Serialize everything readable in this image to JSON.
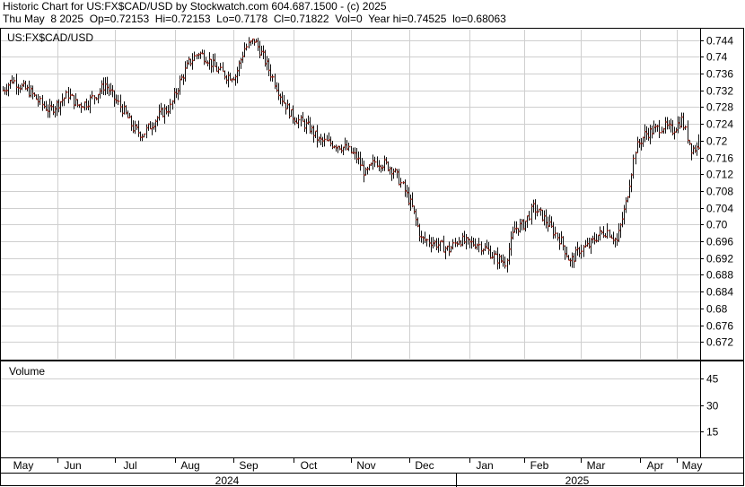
{
  "header": {
    "line1": "Historic Chart for US:FX$CAD/USD by Stockwatch.com 604.687.1500 - (c) 2025",
    "line2": "Thu May  8 2025  Op=0.72153  Hi=0.72153  Lo=0.7178  Cl=0.71822  Vol=0  Year hi=0.74525  lo=0.68063"
  },
  "colors": {
    "bar": "#111111",
    "close_tick": "#c0392b",
    "grid": "#cfcfcf",
    "frame": "#000000",
    "background": "#ffffff"
  },
  "chart_data": [
    {
      "type": "ohlc",
      "title": "US:FX$CAD/USD",
      "y_ticks": [
        "0.744",
        "0.74",
        "0.736",
        "0.732",
        "0.728",
        "0.724",
        "0.72",
        "0.716",
        "0.712",
        "0.708",
        "0.704",
        "0.70",
        "0.696",
        "0.692",
        "0.688",
        "0.684",
        "0.68",
        "0.676",
        "0.672"
      ],
      "ylim": [
        0.668,
        0.7465
      ],
      "x_months": [
        "May",
        "Jun",
        "Jul",
        "Aug",
        "Sep",
        "Oct",
        "Nov",
        "Dec",
        "Jan",
        "Feb",
        "Mar",
        "Apr",
        "May"
      ],
      "x_years": [
        "2024",
        "2025"
      ],
      "grid": true,
      "weekly_close": [
        0.732,
        0.7345,
        0.7328,
        0.7315,
        0.729,
        0.7272,
        0.729,
        0.731,
        0.7285,
        0.729,
        0.731,
        0.7335,
        0.73,
        0.727,
        0.723,
        0.7215,
        0.724,
        0.7265,
        0.728,
        0.734,
        0.7385,
        0.741,
        0.7395,
        0.737,
        0.7355,
        0.7355,
        0.742,
        0.744,
        0.74,
        0.735,
        0.73,
        0.7262,
        0.7245,
        0.723,
        0.72,
        0.7195,
        0.719,
        0.718,
        0.716,
        0.712,
        0.715,
        0.7145,
        0.713,
        0.709,
        0.704,
        0.6965,
        0.696,
        0.695,
        0.694,
        0.6965,
        0.6955,
        0.6955,
        0.694,
        0.692,
        0.691,
        0.699,
        0.7,
        0.704,
        0.702,
        0.699,
        0.696,
        0.691,
        0.694,
        0.695,
        0.6975,
        0.6985,
        0.696,
        0.705,
        0.718,
        0.7215,
        0.7225,
        0.7235,
        0.7225,
        0.725,
        0.7182
      ]
    },
    {
      "type": "bar",
      "title": "Volume",
      "y_ticks": [
        "45",
        "30",
        "15"
      ],
      "ylim": [
        0,
        55
      ],
      "values": []
    }
  ]
}
